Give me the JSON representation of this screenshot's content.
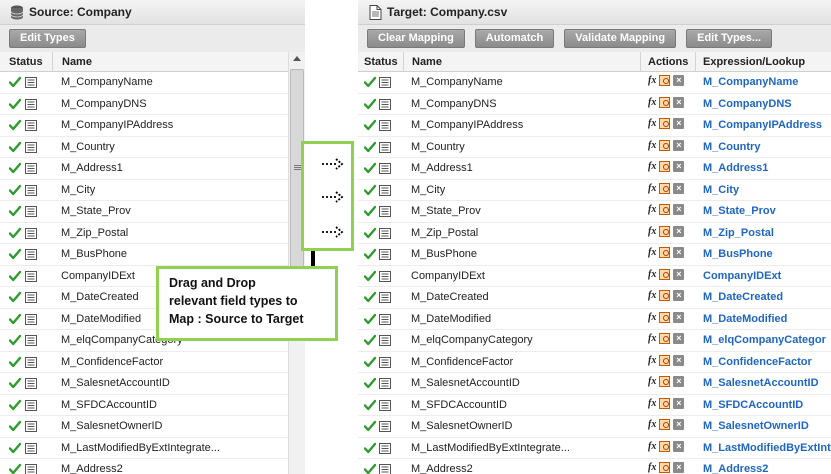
{
  "left": {
    "title": "Source: Company",
    "buttons": {
      "edit_types": "Edit Types"
    },
    "columns": {
      "status": "Status",
      "name": "Name"
    },
    "rows": [
      "M_CompanyName",
      "M_CompanyDNS",
      "M_CompanyIPAddress",
      "M_Country",
      "M_Address1",
      "M_City",
      "M_State_Prov",
      "M_Zip_Postal",
      "M_BusPhone",
      "CompanyIDExt",
      "M_DateCreated",
      "M_DateModified",
      "M_elqCompanyCategory",
      "M_ConfidenceFactor",
      "M_SalesnetAccountID",
      "M_SFDCAccountID",
      "M_SalesnetOwnerID",
      "M_LastModifiedByExtIntegrate...",
      "M_Address2"
    ]
  },
  "right": {
    "title": "Target: Company.csv",
    "buttons": {
      "clear_mapping": "Clear Mapping",
      "automatch": "Automatch",
      "validate_mapping": "Validate Mapping",
      "edit_types": "Edit Types..."
    },
    "columns": {
      "status": "Status",
      "name": "Name",
      "actions": "Actions",
      "expression": "Expression/Lookup"
    },
    "fx_label": "fx",
    "rows": [
      {
        "name": "M_CompanyName",
        "expr": "M_CompanyName"
      },
      {
        "name": "M_CompanyDNS",
        "expr": "M_CompanyDNS"
      },
      {
        "name": "M_CompanyIPAddress",
        "expr": "M_CompanyIPAddress"
      },
      {
        "name": "M_Country",
        "expr": "M_Country"
      },
      {
        "name": "M_Address1",
        "expr": "M_Address1"
      },
      {
        "name": "M_City",
        "expr": "M_City"
      },
      {
        "name": "M_State_Prov",
        "expr": "M_State_Prov"
      },
      {
        "name": "M_Zip_Postal",
        "expr": "M_Zip_Postal"
      },
      {
        "name": "M_BusPhone",
        "expr": "M_BusPhone"
      },
      {
        "name": "CompanyIDExt",
        "expr": "CompanyIDExt"
      },
      {
        "name": "M_DateCreated",
        "expr": "M_DateCreated"
      },
      {
        "name": "M_DateModified",
        "expr": "M_DateModified"
      },
      {
        "name": "M_elqCompanyCategory",
        "expr": "M_elqCompanyCategor"
      },
      {
        "name": "M_ConfidenceFactor",
        "expr": "M_ConfidenceFactor"
      },
      {
        "name": "M_SalesnetAccountID",
        "expr": "M_SalesnetAccountID"
      },
      {
        "name": "M_SFDCAccountID",
        "expr": "M_SFDCAccountID"
      },
      {
        "name": "M_SalesnetOwnerID",
        "expr": "M_SalesnetOwnerID"
      },
      {
        "name": "M_LastModifiedByExtIntegrate...",
        "expr": "M_LastModifiedByExtInt"
      },
      {
        "name": "M_Address2",
        "expr": "M_Address2"
      }
    ]
  },
  "annotation": {
    "lines": [
      "Drag and Drop",
      "relevant field types to",
      "Map : Source to Target"
    ]
  },
  "colors": {
    "accent_green": "#92d050",
    "expr_blue": "#1f66c2",
    "check_green": "#2e9b2e",
    "button_gray": "#969696"
  }
}
